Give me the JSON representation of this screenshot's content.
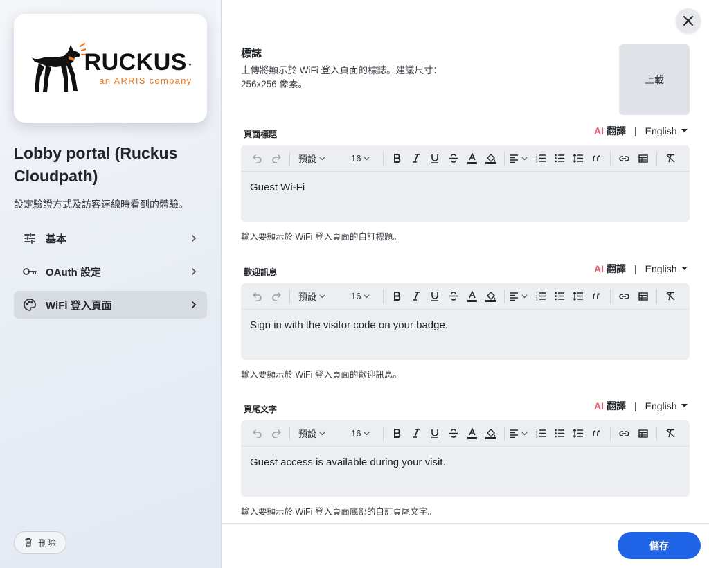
{
  "sidebar": {
    "logo": {
      "main": "RUCKUS",
      "tm": "™",
      "sub": "an ARRIS company"
    },
    "title": "Lobby portal (Ruckus Cloudpath)",
    "description": "設定驗證方式及訪客連線時看到的體驗。",
    "nav": [
      {
        "label": "基本",
        "icon": "sliders-icon"
      },
      {
        "label": "OAuth 設定",
        "icon": "key-icon"
      },
      {
        "label": "WiFi 登入頁面",
        "icon": "palette-icon",
        "active": true
      }
    ],
    "delete_label": "刪除"
  },
  "logo_section": {
    "title": "標誌",
    "description": "上傳將顯示於 WiFi 登入頁面的標誌。建議尺寸：256x256 像素。",
    "upload_label": "上載"
  },
  "translate": {
    "ai": "AI",
    "label": "翻譯",
    "separator": "|",
    "language": "English"
  },
  "toolbar": {
    "format": "預設",
    "size": "16"
  },
  "fields": [
    {
      "label": "頁面標題",
      "value": "Guest Wi-Fi",
      "hint": "輸入要顯示於 WiFi 登入頁面的自訂標題。"
    },
    {
      "label": "歡迎訊息",
      "value": "Sign in with the visitor code on your badge.",
      "hint": "輸入要顯示於 WiFi 登入頁面的歡迎訊息。"
    },
    {
      "label": "頁尾文字",
      "value": "Guest access is available during your visit.",
      "hint": "輸入要顯示於 WiFi 登入頁面底部的自訂頁尾文字。"
    }
  ],
  "save_label": "儲存",
  "colors": {
    "accent": "#1f63e6",
    "ai": "#e5566f",
    "brand_orange": "#e87722"
  }
}
